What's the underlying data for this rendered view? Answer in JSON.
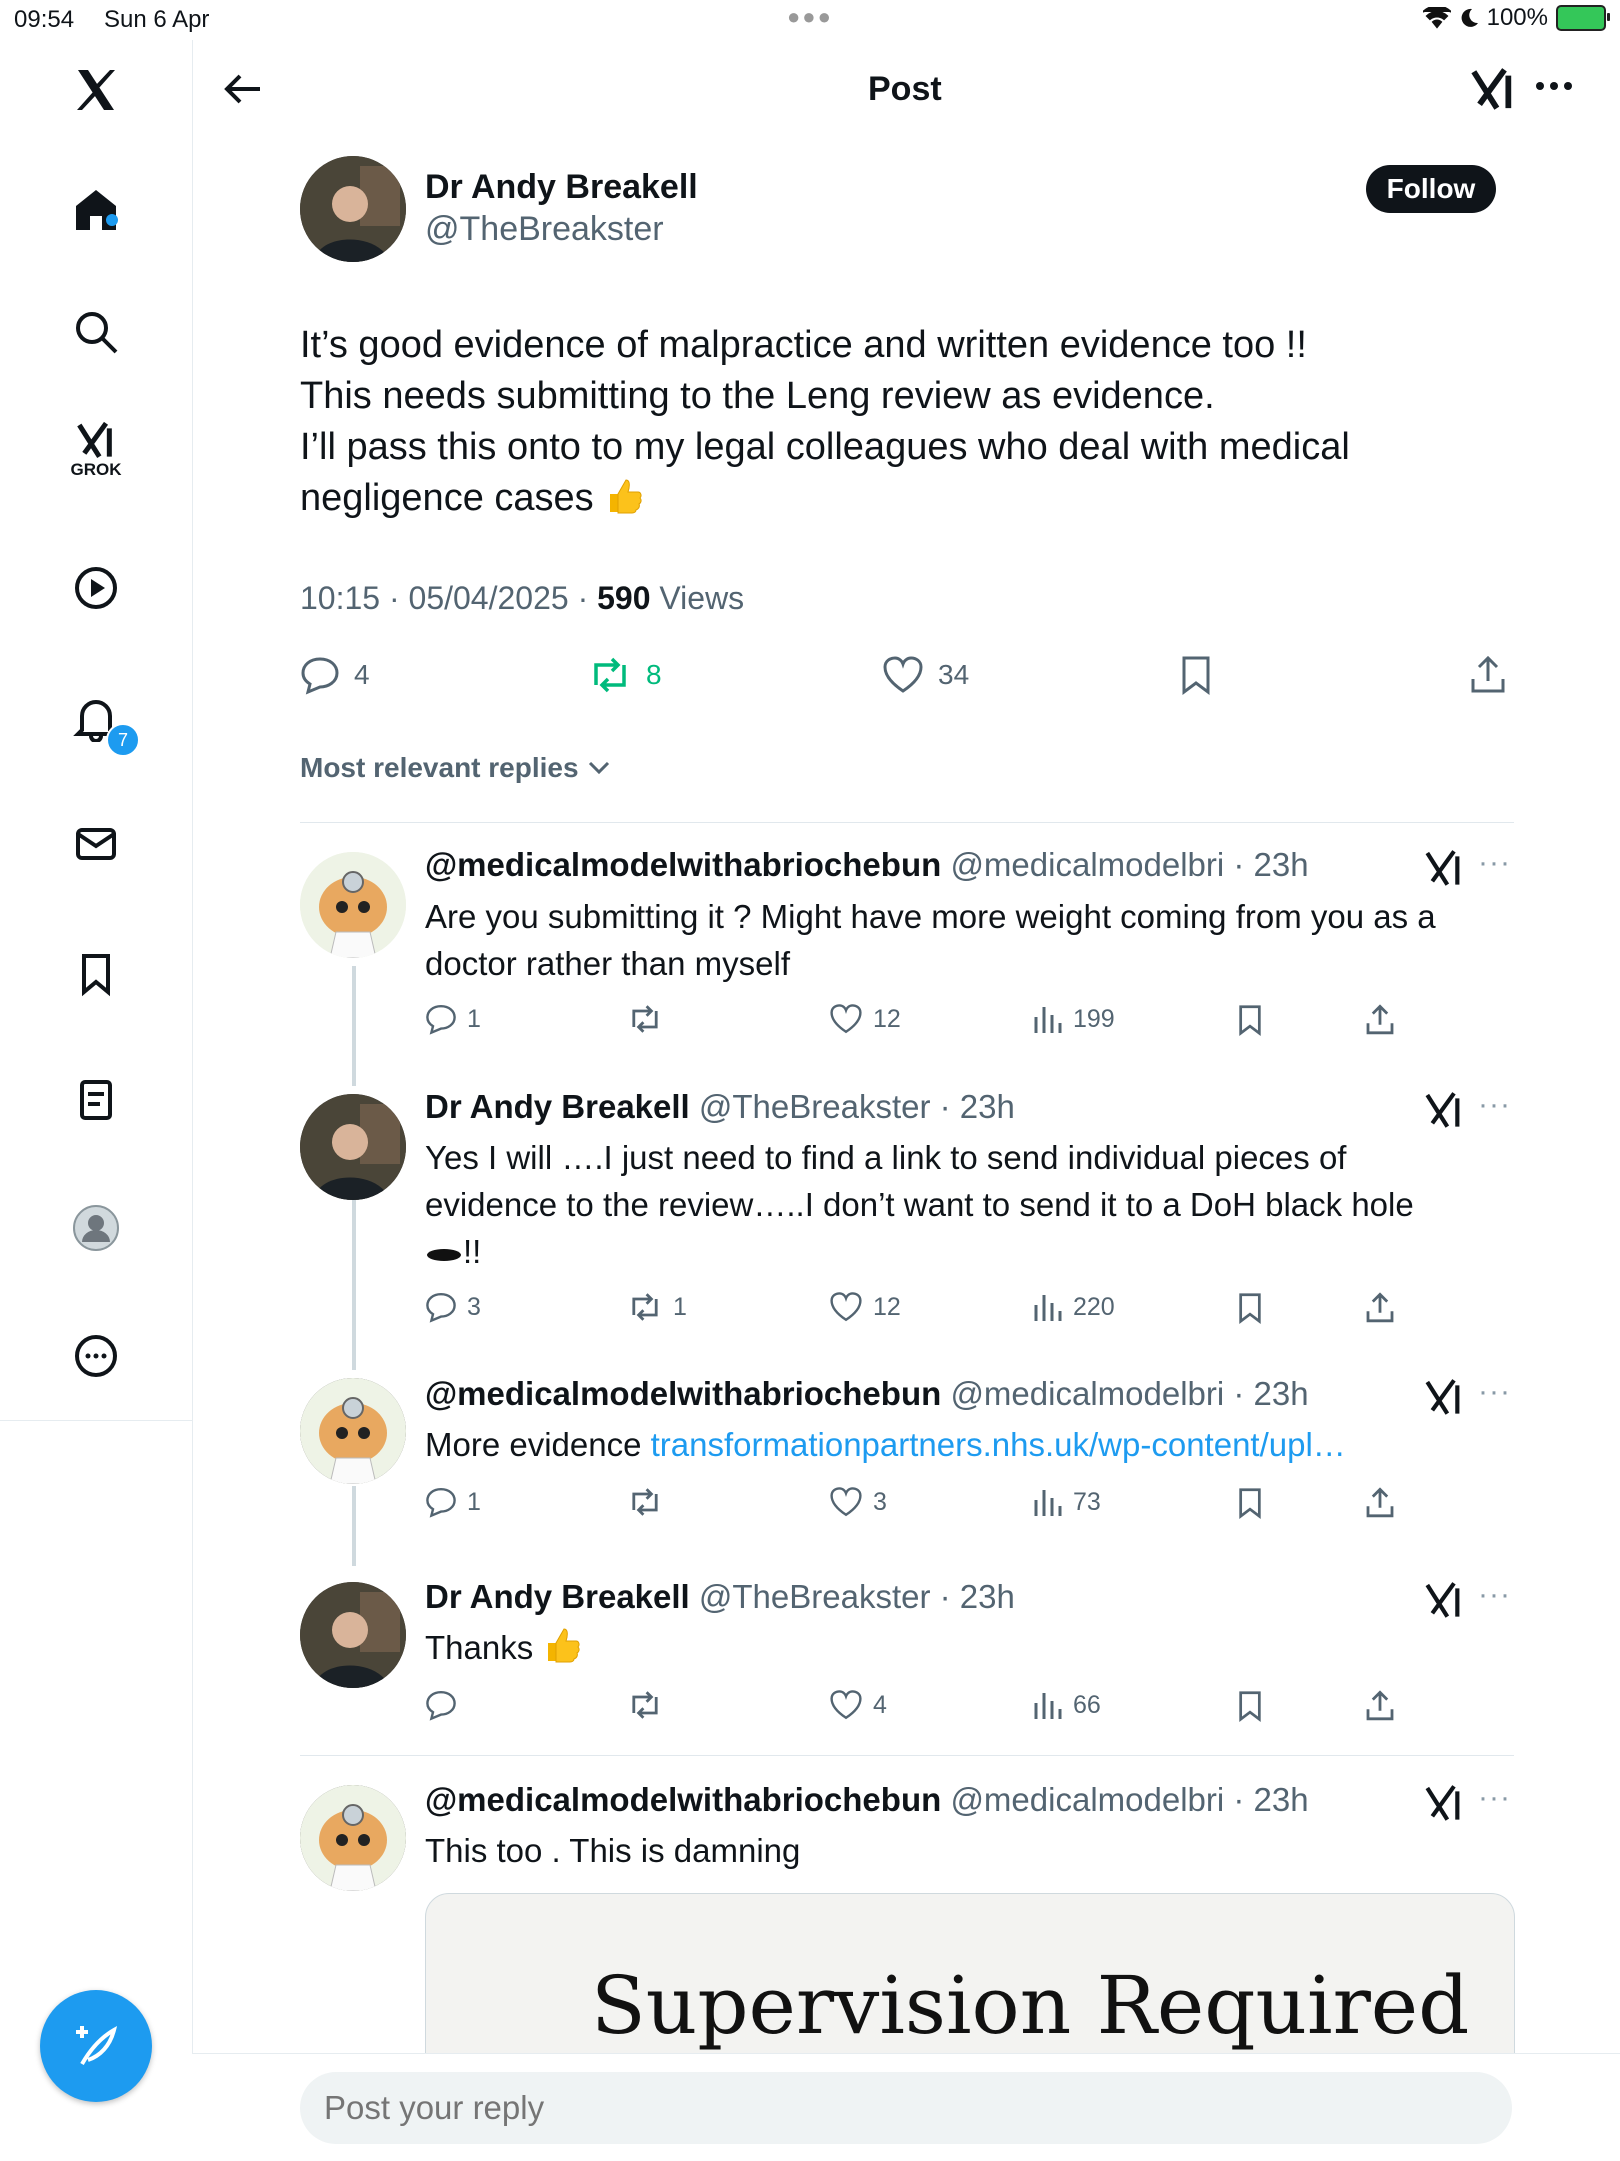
{
  "status": {
    "time": "09:54",
    "date": "Sun 6 Apr",
    "battery": "100%"
  },
  "sidebar": {
    "notification_count": "7",
    "grok_label": "GROK"
  },
  "header": {
    "title": "Post"
  },
  "post": {
    "author_name": "Dr Andy Breakell",
    "author_handle": "@TheBreakster",
    "follow_label": "Follow",
    "lines": [
      "It’s good evidence of malpractice and written evidence too !!",
      "This needs submitting to the Leng review as evidence.",
      "I’ll pass this onto to my legal colleagues who deal with medical",
      "negligence cases"
    ],
    "timestamp": "10:15 · 05/04/2025 · ",
    "views_count": "590",
    "views_label": " Views",
    "replies": "4",
    "reposts": "8",
    "likes": "34"
  },
  "sort_label": "Most relevant replies",
  "replies": [
    {
      "name": "@medicalmodelwithabriochebun",
      "handle": "@medicalmodelbri · 23h",
      "lines": [
        "Are you submitting it ? Might have more weight coming from you as a",
        "doctor rather than myself"
      ],
      "replies": "1",
      "reposts": "",
      "likes": "12",
      "views": "199"
    },
    {
      "name": "Dr Andy Breakell",
      "handle": "@TheBreakster · 23h",
      "lines": [
        "Yes I will ….I just need to find a link to send individual pieces of",
        "evidence to the review…..I don’t want to send it to a DoH black hole",
        "!!"
      ],
      "replies": "3",
      "reposts": "1",
      "likes": "12",
      "views": "220"
    },
    {
      "name": "@medicalmodelwithabriochebun",
      "handle": "@medicalmodelbri · 23h",
      "text_prefix": "More evidence ",
      "link": "transformationpartners.nhs.uk/wp-content/upl…",
      "replies": "1",
      "reposts": "",
      "likes": "3",
      "views": "73"
    },
    {
      "name": "Dr Andy Breakell",
      "handle": "@TheBreakster · 23h",
      "lines": [
        "Thanks"
      ],
      "replies": "",
      "reposts": "",
      "likes": "4",
      "views": "66"
    },
    {
      "name": "@medicalmodelwithabriochebun",
      "handle": "@medicalmodelbri · 23h",
      "lines": [
        "This too . This is damning"
      ],
      "media_title": "Supervision Required"
    }
  ],
  "reply_bar": {
    "placeholder": "Post your reply"
  },
  "colors": {
    "accent": "#1d9bf0",
    "repost_green": "#00ba7c",
    "text_secondary": "#536471"
  }
}
